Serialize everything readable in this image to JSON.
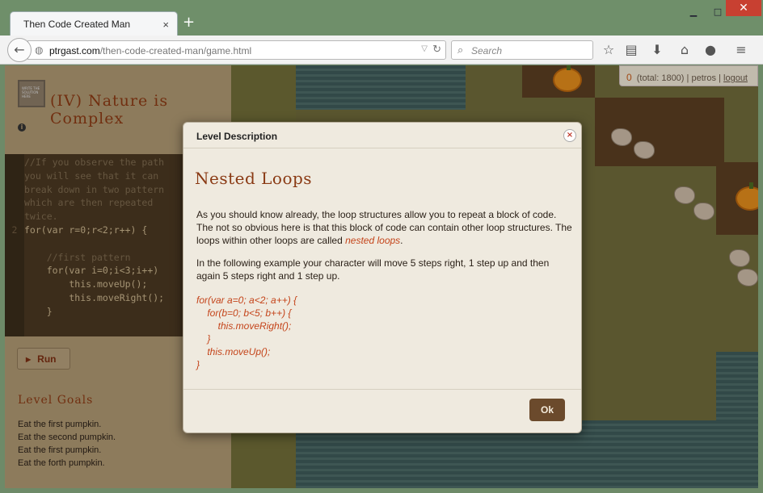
{
  "browser": {
    "tab_title": "Then Code Created Man",
    "tab_close": "×",
    "new_tab": "+",
    "url_host": "ptrgast.com",
    "url_path": "/then-code-created-man/game.html",
    "search_placeholder": "Search",
    "toolbar_icons": [
      "bookmark-star-icon",
      "reading-list-icon",
      "download-icon",
      "home-icon",
      "chat-icon",
      "menu-icon"
    ]
  },
  "sidebar": {
    "level_title": "(IV) Nature is Complex",
    "badge_text": "WRITE THE SOLUTION HERE",
    "code_lines": [
      {
        "num": "",
        "text": "//If you observe the path",
        "kind": "comment"
      },
      {
        "num": "",
        "text": "you will see that it can",
        "kind": "comment"
      },
      {
        "num": "",
        "text": "break down in two pattern",
        "kind": "comment"
      },
      {
        "num": "",
        "text": "which are then repeated",
        "kind": "comment"
      },
      {
        "num": "",
        "text": "twice.",
        "kind": "comment"
      },
      {
        "num": "2",
        "text": "for(var r=0;r<2;r++) {",
        "kind": "code"
      },
      {
        "num": "",
        "text": "",
        "kind": "code"
      },
      {
        "num": "",
        "text": "    //first pattern",
        "kind": "comment"
      },
      {
        "num": "",
        "text": "    for(var i=0;i<3;i++)",
        "kind": "code"
      },
      {
        "num": "",
        "text": "        this.moveUp();",
        "kind": "code"
      },
      {
        "num": "",
        "text": "        this.moveRight();",
        "kind": "code"
      },
      {
        "num": "",
        "text": "    }",
        "kind": "code"
      }
    ],
    "run_label": "Run",
    "goals_title": "Level Goals",
    "goals": [
      "Eat the first pumpkin.",
      "Eat the second pumpkin.",
      "Eat the first pumpkin.",
      "Eat the forth pumpkin."
    ]
  },
  "score": {
    "value": "0",
    "total": "(total: 1800)",
    "user": "petros",
    "logout": "logout"
  },
  "modal": {
    "header": "Level Description",
    "close": "×",
    "heading": "Nested Loops",
    "p1_before": "As you should know already, the loop structures allow you to repeat a block of code. The not so obvious here is that this block of code can contain other loop structures. The loops within other loops are called ",
    "p1_em": "nested loops",
    "p1_after": ".",
    "p2": "In the following example your character will move 5 steps right, 1 step up and then again 5 steps right and 1 step up.",
    "code_example": "for(var a=0; a<2; a++) {\n    for(b=0; b<5; b++) {\n        this.moveRight();\n    }\n    this.moveUp();\n}",
    "ok_label": "Ok"
  },
  "colors": {
    "accent": "#8a3a14",
    "code_highlight": "#c4441a",
    "ok_button": "#6b4a2c",
    "close_button": "#c84031"
  }
}
